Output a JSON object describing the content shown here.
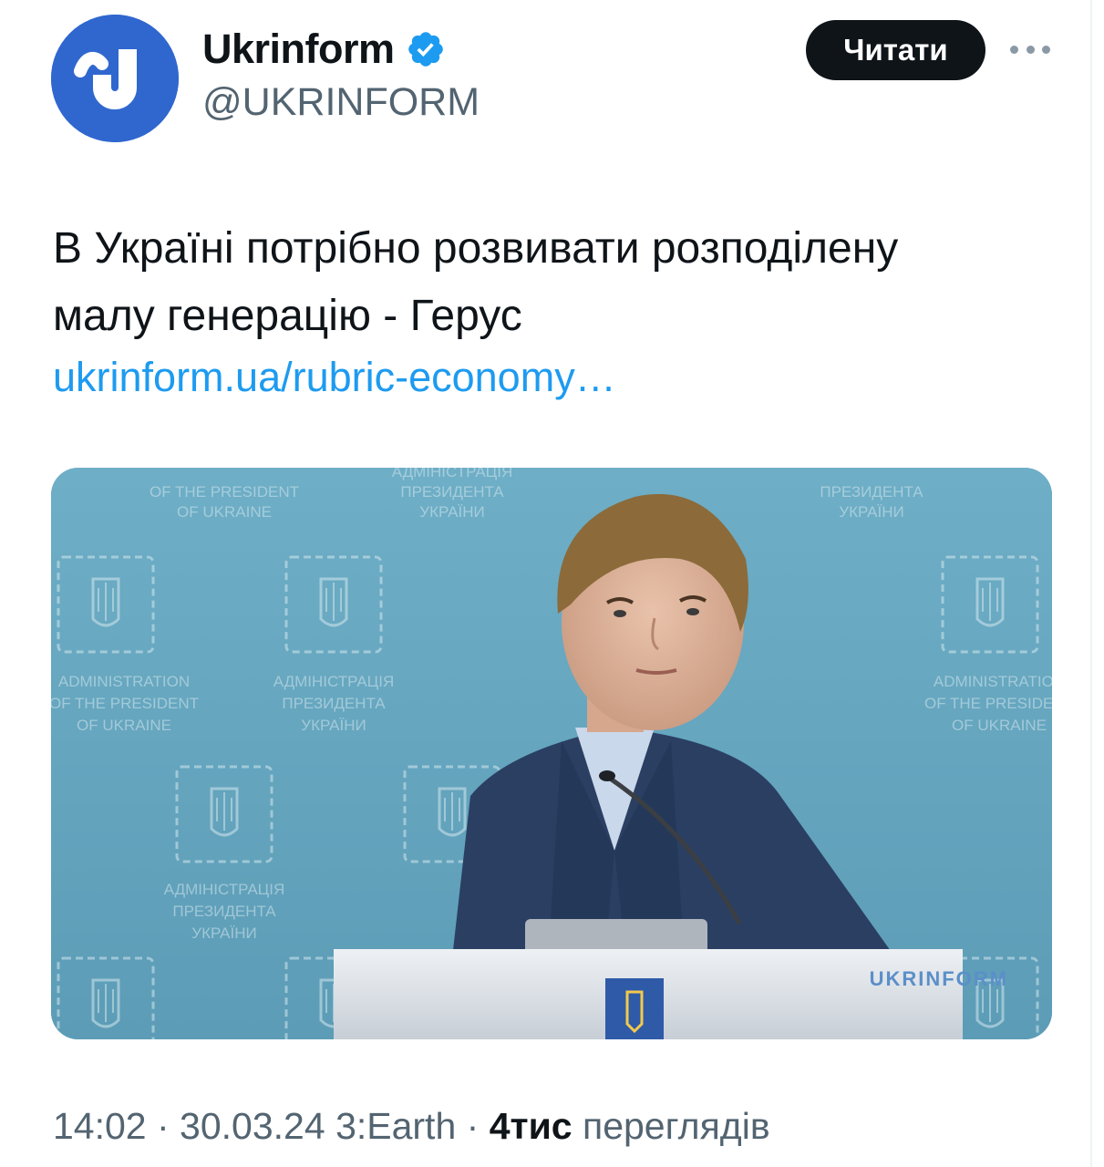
{
  "account": {
    "display_name": "Ukrinform",
    "handle": "@UKRINFORM",
    "verified": true,
    "avatar_icon": "ukrinform-logo-icon",
    "avatar_color": "#3067cf",
    "badge_color": "#1d9bf0"
  },
  "actions": {
    "follow_label": "Читати",
    "more_icon": "more-dots-icon"
  },
  "tweet": {
    "text_lines": [
      "В Україні потрібно розвивати розподілену",
      "малу генерацію - Герус"
    ],
    "link_text": "ukrinform.ua/rubric-economy…",
    "link_color": "#1d9bf0"
  },
  "media": {
    "backdrop_lines_en": [
      "ADMINISTRATION",
      "OF THE PRESIDENT",
      "OF UKRAINE"
    ],
    "backdrop_lines_ua": [
      "АДМІНІСТРАЦІЯ",
      "ПРЕЗИДЕНТА",
      "УКРАЇНИ"
    ],
    "watermark": "UKRINFORM",
    "backdrop_color": "#67a6bf"
  },
  "meta": {
    "time": "14:02",
    "separator": " · ",
    "date": "30.03.24",
    "client": "3:Earth",
    "views_count": "4тис",
    "views_label": "переглядів"
  }
}
